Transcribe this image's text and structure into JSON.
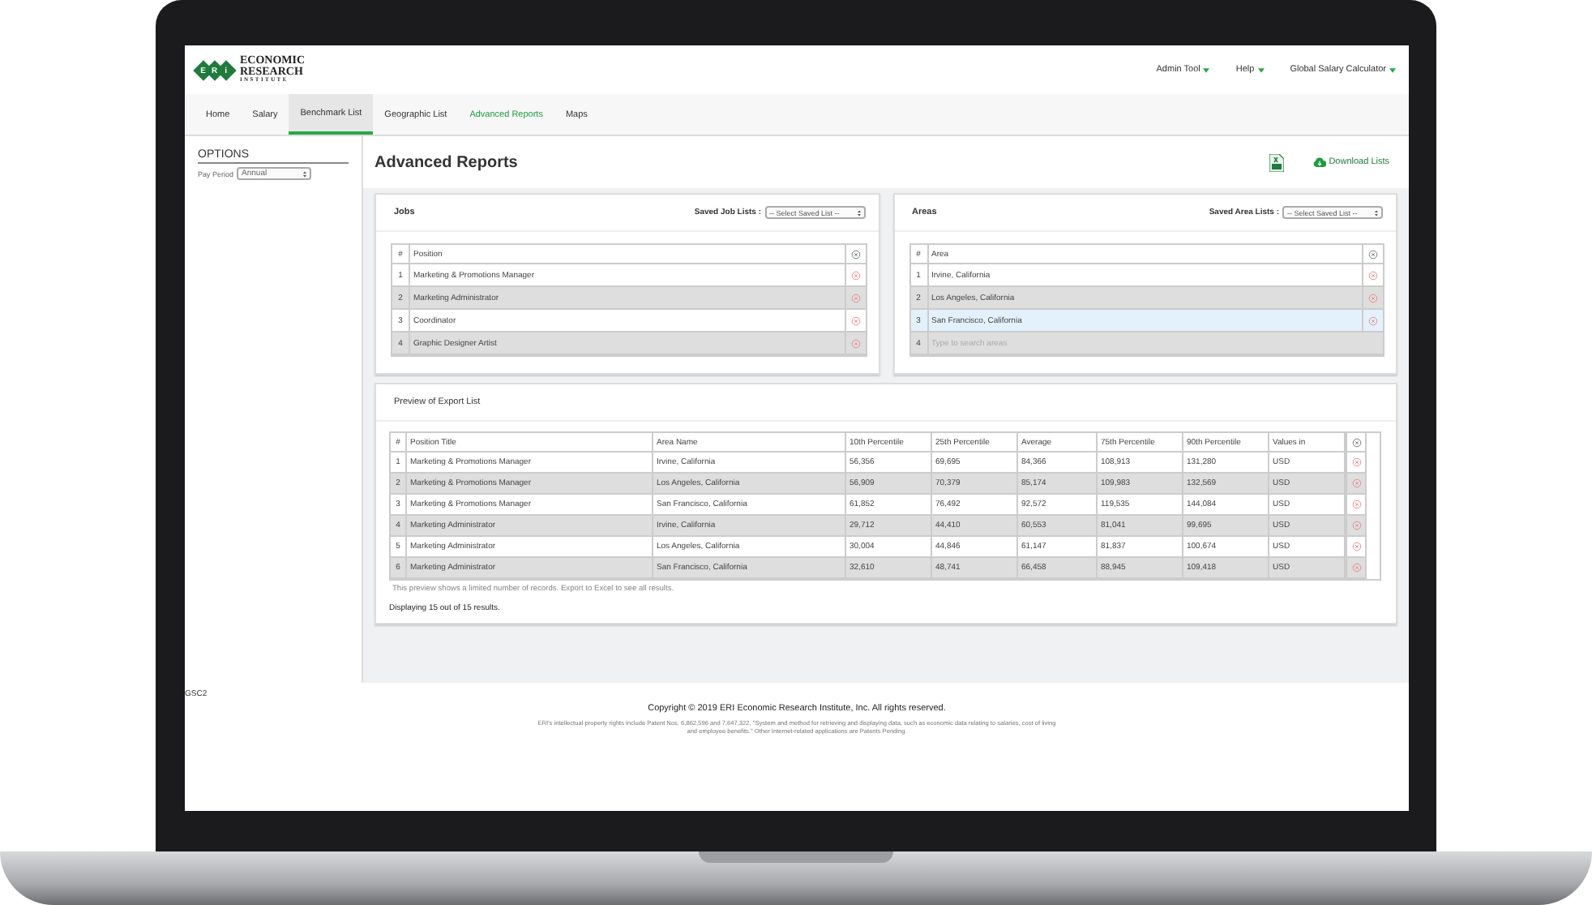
{
  "header": {
    "logo": {
      "letters": [
        "E",
        "R",
        "i"
      ],
      "lines": [
        "ECONOMIC",
        "RESEARCH",
        "INSTITUTE"
      ]
    },
    "menus": [
      "Admin Tool",
      "Help",
      "Global Salary Calculator"
    ]
  },
  "tabs": [
    {
      "label": "Home",
      "selected": false,
      "highlighted": false
    },
    {
      "label": "Salary",
      "selected": false,
      "highlighted": false
    },
    {
      "label": "Benchmark List",
      "selected": true,
      "highlighted": false
    },
    {
      "label": "Geographic List",
      "selected": false,
      "highlighted": false
    },
    {
      "label": "Advanced Reports",
      "selected": false,
      "highlighted": true
    },
    {
      "label": "Maps",
      "selected": false,
      "highlighted": false
    }
  ],
  "sidebar": {
    "title": "OPTIONS",
    "pay_period": {
      "label": "Pay Period",
      "value": "Annual"
    }
  },
  "page": {
    "title": "Advanced Reports",
    "download": "Download Lists"
  },
  "jobs": {
    "title": "Jobs",
    "saved_label": "Saved Job Lists :",
    "select": "-- Select Saved List --",
    "columns": [
      "#",
      "Position"
    ],
    "rows": [
      {
        "num": "1",
        "text": "Marketing & Promotions Manager",
        "selected": false
      },
      {
        "num": "2",
        "text": "Marketing Administrator",
        "selected": false
      },
      {
        "num": "3",
        "text": "Coordinator",
        "selected": false
      },
      {
        "num": "4",
        "text": "Graphic Designer Artist",
        "selected": false
      }
    ]
  },
  "areas": {
    "title": "Areas",
    "saved_label": "Saved Area Lists :",
    "select": "-- Select Saved List --",
    "columns": [
      "#",
      "Area"
    ],
    "rows": [
      {
        "num": "1",
        "text": "Irvine, California",
        "selected": false
      },
      {
        "num": "2",
        "text": "Los Angeles, California",
        "selected": false
      },
      {
        "num": "3",
        "text": "San Francisco, California",
        "selected": true
      }
    ],
    "search": {
      "num": "4",
      "placeholder": "Type to search areas"
    }
  },
  "preview": {
    "title": "Preview of Export List",
    "columns": [
      "#",
      "Position Title",
      "Area Name",
      "10th Percentile",
      "25th Percentile",
      "Average",
      "75th Percentile",
      "90th Percentile",
      "Values in"
    ],
    "rows": [
      [
        "1",
        "Marketing & Promotions Manager",
        "Irvine, California",
        "56,356",
        "69,695",
        "84,366",
        "108,913",
        "131,280",
        "USD"
      ],
      [
        "2",
        "Marketing & Promotions Manager",
        "Los Angeles, California",
        "56,909",
        "70,379",
        "85,174",
        "109,983",
        "132,569",
        "USD"
      ],
      [
        "3",
        "Marketing & Promotions Manager",
        "San Francisco, California",
        "61,852",
        "76,492",
        "92,572",
        "119,535",
        "144,084",
        "USD"
      ],
      [
        "4",
        "Marketing Administrator",
        "Irvine, California",
        "29,712",
        "44,410",
        "60,553",
        "81,041",
        "99,695",
        "USD"
      ],
      [
        "5",
        "Marketing Administrator",
        "Los Angeles, California",
        "30,004",
        "44,846",
        "61,147",
        "81,837",
        "100,674",
        "USD"
      ],
      [
        "6",
        "Marketing Administrator",
        "San Francisco, California",
        "32,610",
        "48,741",
        "66,458",
        "88,945",
        "109,418",
        "USD"
      ]
    ],
    "note": "This preview shows a limited number of records. Export to Excel to see all results.",
    "count": "Displaying 15 out of 15 results."
  },
  "footer": {
    "code": "GSC2",
    "copyright": "Copyright © 2019 ERI Economic Research Institute, Inc. All rights reserved.",
    "legal": "ERI's intellectual property rights include Patent Nos. 6,862,596 and 7,647,322, \"System and method for retrieving and displaying data, such as economic data relating to salaries, cost of living and employee benefits.\" Other Internet-related applications are Patents Pending."
  }
}
